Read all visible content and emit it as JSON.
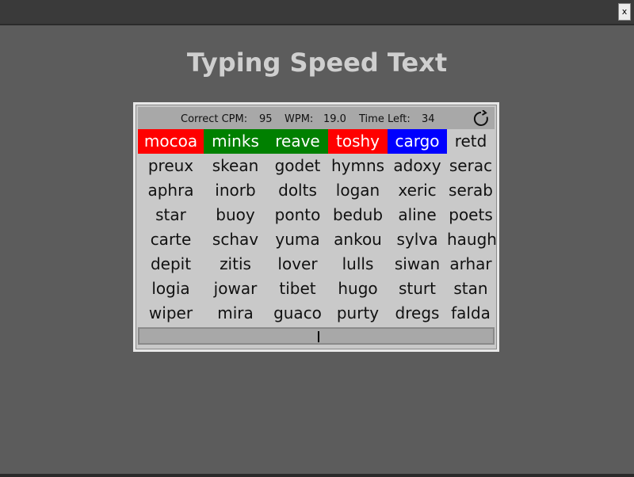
{
  "window": {
    "close_label": "x"
  },
  "title": "Typing Speed Text",
  "stats": {
    "cpm_label": "Correct CPM:",
    "cpm_value": "95",
    "wpm_label": "WPM:",
    "wpm_value": "19.0",
    "time_label": "Time Left:",
    "time_value": "34"
  },
  "status_colors": {
    "correct": "#008000",
    "incorrect": "#ff0000",
    "current": "#0000ff",
    "pending": "transparent"
  },
  "rows": [
    [
      {
        "text": "mocoa",
        "status": "incorrect"
      },
      {
        "text": "minks",
        "status": "correct"
      },
      {
        "text": "reave",
        "status": "correct"
      },
      {
        "text": "toshy",
        "status": "incorrect"
      },
      {
        "text": "cargo",
        "status": "current"
      },
      {
        "text": "retd",
        "status": "pending"
      }
    ],
    [
      {
        "text": "preux"
      },
      {
        "text": "skean"
      },
      {
        "text": "godet"
      },
      {
        "text": "hymns"
      },
      {
        "text": "adoxy"
      },
      {
        "text": "serac"
      }
    ],
    [
      {
        "text": "aphra"
      },
      {
        "text": "inorb"
      },
      {
        "text": "dolts"
      },
      {
        "text": "logan"
      },
      {
        "text": "xeric"
      },
      {
        "text": "serab"
      }
    ],
    [
      {
        "text": "star"
      },
      {
        "text": "buoy"
      },
      {
        "text": "ponto"
      },
      {
        "text": "bedub"
      },
      {
        "text": "aline"
      },
      {
        "text": "poets"
      }
    ],
    [
      {
        "text": "carte"
      },
      {
        "text": "schav"
      },
      {
        "text": "yuma"
      },
      {
        "text": "ankou"
      },
      {
        "text": "sylva"
      },
      {
        "text": "haugh"
      }
    ],
    [
      {
        "text": "depit"
      },
      {
        "text": "zitis"
      },
      {
        "text": "lover"
      },
      {
        "text": "lulls"
      },
      {
        "text": "siwan"
      },
      {
        "text": "arhar"
      }
    ],
    [
      {
        "text": "logia"
      },
      {
        "text": "jowar"
      },
      {
        "text": "tibet"
      },
      {
        "text": "hugo"
      },
      {
        "text": "sturt"
      },
      {
        "text": "stan"
      }
    ],
    [
      {
        "text": "wiper"
      },
      {
        "text": "mira"
      },
      {
        "text": "guaco"
      },
      {
        "text": "purty"
      },
      {
        "text": "dregs"
      },
      {
        "text": "falda"
      }
    ]
  ],
  "input": {
    "value": ""
  }
}
